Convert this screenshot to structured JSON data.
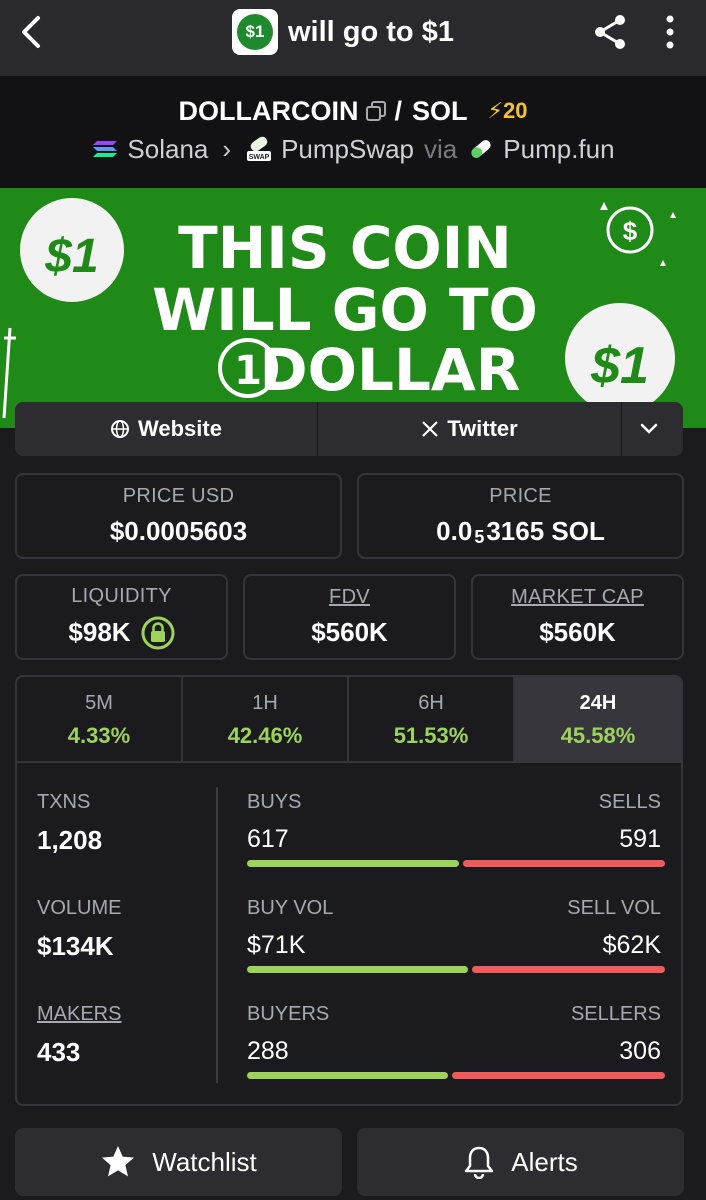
{
  "header": {
    "title": "will go to $1",
    "app_icon_text": "$1",
    "back_icon": "chevron-left-icon",
    "share_icon": "share-icon",
    "more_icon": "more-vertical-icon"
  },
  "pair": {
    "base": "DOLLARCOIN",
    "separator": "/",
    "quote": "SOL",
    "boost": "⚡20",
    "chain": "Solana",
    "chevron": "›",
    "dex": "PumpSwap",
    "via": "via",
    "launchpad": "Pump.fun",
    "dex_icon_text": "SWAP"
  },
  "banner": {
    "line1": "THIS COIN",
    "line2": "WILL GO TO",
    "line3_num": "1",
    "line3_word": "DOLLAR",
    "coin_text": "$1"
  },
  "links": {
    "website": "Website",
    "twitter": "Twitter"
  },
  "stats": {
    "price_usd_label": "PRICE USD",
    "price_usd_value": "$0.0005603",
    "price_label": "PRICE",
    "price_prefix": "0.0",
    "price_sub": "5",
    "price_suffix": "3165 SOL",
    "liquidity_label": "LIQUIDITY",
    "liquidity_value": "$98K",
    "fdv_label": "FDV",
    "fdv_value": "$560K",
    "mcap_label": "MARKET CAP",
    "mcap_value": "$560K"
  },
  "timeframes": [
    {
      "label": "5M",
      "change": "4.33%"
    },
    {
      "label": "1H",
      "change": "42.46%"
    },
    {
      "label": "6H",
      "change": "51.53%"
    },
    {
      "label": "24H",
      "change": "45.58%"
    }
  ],
  "active_timeframe": "24H",
  "txns": {
    "txns_label": "TXNS",
    "txns_value": "1,208",
    "volume_label": "VOLUME",
    "volume_value": "$134K",
    "makers_label": "MAKERS",
    "makers_value": "433",
    "buys_label": "BUYS",
    "buys_value": "617",
    "sells_label": "SELLS",
    "sells_value": "591",
    "buyvol_label": "BUY VOL",
    "buyvol_value": "$71K",
    "sellvol_label": "SELL VOL",
    "sellvol_value": "$62K",
    "buyers_label": "BUYERS",
    "buyers_value": "288",
    "sellers_label": "SELLERS",
    "sellers_value": "306",
    "buys_fraction": 0.511,
    "buyvol_fraction": 0.534,
    "buyers_fraction": 0.485
  },
  "actions": {
    "watchlist": "Watchlist",
    "alerts": "Alerts"
  },
  "colors": {
    "positive": "#9dd35a",
    "negative": "#f05a5a",
    "boost": "#f4c430",
    "banner_green": "#1f8a18"
  }
}
